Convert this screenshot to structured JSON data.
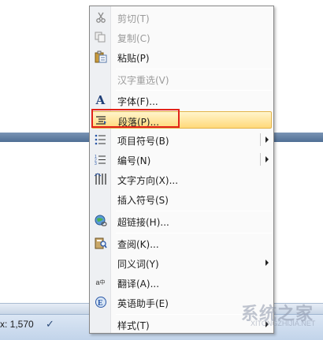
{
  "context_menu": {
    "items": [
      {
        "label": "剪切(T)",
        "icon": "scissors-icon",
        "disabled": true,
        "submenu": false
      },
      {
        "label": "复制(C)",
        "icon": "copy-icon",
        "disabled": true,
        "submenu": false
      },
      {
        "label": "粘贴(P)",
        "icon": "paste-icon",
        "disabled": false,
        "submenu": false
      },
      {
        "label": "汉字重选(V)",
        "icon": "",
        "disabled": true,
        "submenu": false
      },
      {
        "label": "字体(F)...",
        "icon": "font-icon",
        "disabled": false,
        "submenu": false
      },
      {
        "label": "段落(P)...",
        "icon": "paragraph-icon",
        "disabled": false,
        "submenu": false,
        "highlighted": true
      },
      {
        "label": "项目符号(B)",
        "icon": "bullets-icon",
        "disabled": false,
        "submenu": true
      },
      {
        "label": "编号(N)",
        "icon": "numbering-icon",
        "disabled": false,
        "submenu": true
      },
      {
        "label": "文字方向(X)...",
        "icon": "text-direction-icon",
        "disabled": false,
        "submenu": false
      },
      {
        "label": "插入符号(S)",
        "icon": "",
        "disabled": false,
        "submenu": false
      },
      {
        "label": "超链接(H)...",
        "icon": "hyperlink-icon",
        "disabled": false,
        "submenu": false
      },
      {
        "label": "查阅(K)...",
        "icon": "research-icon",
        "disabled": false,
        "submenu": false
      },
      {
        "label": "同义词(Y)",
        "icon": "",
        "disabled": false,
        "submenu": true
      },
      {
        "label": "翻译(A)...",
        "icon": "translate-icon",
        "disabled": false,
        "submenu": false
      },
      {
        "label": "英语助手(E)",
        "icon": "english-assistant-icon",
        "disabled": false,
        "submenu": false
      },
      {
        "label": "样式(T)",
        "icon": "",
        "disabled": false,
        "submenu": true
      }
    ]
  },
  "status_bar": {
    "text": "x: 1,570"
  },
  "colors": {
    "highlight_border": "#e2231a",
    "highlight_fill": "#ffd97a"
  },
  "watermark": {
    "text": "系统之家",
    "sub": "XITONGZHIJIA.NET"
  }
}
